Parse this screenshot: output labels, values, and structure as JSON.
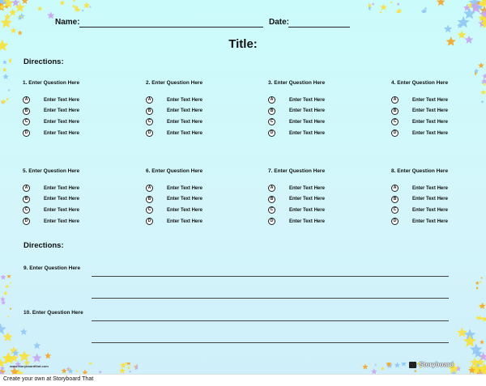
{
  "header": {
    "name_label": "Name:",
    "date_label": "Date:"
  },
  "title": "Title:",
  "section1": {
    "directions": "Directions:",
    "questions": [
      {
        "label": "1. Enter Question Here",
        "options": [
          {
            "letter": "A",
            "text": "Enter Text Here"
          },
          {
            "letter": "B",
            "text": "Enter Text Here"
          },
          {
            "letter": "C",
            "text": "Enter Text Here"
          },
          {
            "letter": "D",
            "text": "Enter Text Here"
          }
        ]
      },
      {
        "label": "2. Enter Question Here",
        "options": [
          {
            "letter": "A",
            "text": "Enter Text Here"
          },
          {
            "letter": "B",
            "text": "Enter Text Here"
          },
          {
            "letter": "C",
            "text": "Enter Text Here"
          },
          {
            "letter": "D",
            "text": "Enter Text Here"
          }
        ]
      },
      {
        "label": "3. Enter Question Here",
        "options": [
          {
            "letter": "A",
            "text": "Enter Text Here"
          },
          {
            "letter": "B",
            "text": "Enter Text Here"
          },
          {
            "letter": "C",
            "text": "Enter Text Here"
          },
          {
            "letter": "D",
            "text": "Enter Text Here"
          }
        ]
      },
      {
        "label": "4. Enter Question Here",
        "options": [
          {
            "letter": "A",
            "text": "Enter Text Here"
          },
          {
            "letter": "B",
            "text": "Enter Text Here"
          },
          {
            "letter": "C",
            "text": "Enter Text Here"
          },
          {
            "letter": "D",
            "text": "Enter Text Here"
          }
        ]
      },
      {
        "label": "5. Enter Question Here",
        "options": [
          {
            "letter": "A",
            "text": "Enter Text Here"
          },
          {
            "letter": "B",
            "text": "Enter Text Here"
          },
          {
            "letter": "C",
            "text": "Enter Text Here"
          },
          {
            "letter": "D",
            "text": "Enter Text Here"
          }
        ]
      },
      {
        "label": "6. Enter Question Here",
        "options": [
          {
            "letter": "A",
            "text": "Enter Text Here"
          },
          {
            "letter": "B",
            "text": "Enter Text Here"
          },
          {
            "letter": "C",
            "text": "Enter Text Here"
          },
          {
            "letter": "D",
            "text": "Enter Text Here"
          }
        ]
      },
      {
        "label": "7. Enter Question Here",
        "options": [
          {
            "letter": "A",
            "text": "Enter Text Here"
          },
          {
            "letter": "B",
            "text": "Enter Text Here"
          },
          {
            "letter": "C",
            "text": "Enter Text Here"
          },
          {
            "letter": "D",
            "text": "Enter Text Here"
          }
        ]
      },
      {
        "label": "8. Enter Question Here",
        "options": [
          {
            "letter": "A",
            "text": "Enter Text Here"
          },
          {
            "letter": "B",
            "text": "Enter Text Here"
          },
          {
            "letter": "C",
            "text": "Enter Text Here"
          },
          {
            "letter": "D",
            "text": "Enter Text Here"
          }
        ]
      }
    ]
  },
  "section2": {
    "directions": "Directions:",
    "questions": [
      {
        "label": "9. Enter Question Here"
      },
      {
        "label": "10. Enter Question Here"
      }
    ]
  },
  "watermark": {
    "url": "www.storyboardthat.com",
    "brand": "Storyboard"
  },
  "footer": "Create your own at Storyboard That",
  "colors": {
    "background": "#cbfbfb",
    "star_yellow": "#f7e23a",
    "star_orange": "#f5a623",
    "star_purple": "#c9a6f0",
    "star_blue": "#8fc8f5"
  },
  "icons": [
    "star-icon",
    "storyboard-logo-icon"
  ]
}
